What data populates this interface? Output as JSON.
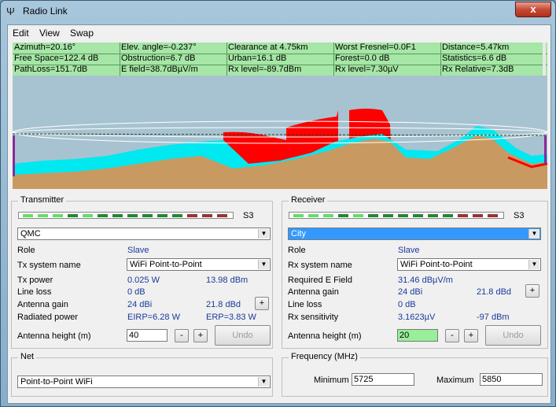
{
  "window": {
    "title": "Radio Link",
    "close_label": "x"
  },
  "menu": {
    "edit": "Edit",
    "view": "View",
    "swap": "Swap"
  },
  "info": {
    "row1": [
      "Azimuth=20.16°",
      "Elev. angle=-0.237°",
      "Clearance at 4.75km",
      "Worst Fresnel=0.0F1",
      "Distance=5.47km"
    ],
    "row2": [
      "Free Space=122.4 dB",
      "Obstruction=6.7 dB",
      "Urban=16.1 dB",
      "Forest=0.0 dB",
      "Statistics=6.6 dB"
    ],
    "row3": [
      "PathLoss=151.7dB",
      "E field=38.7dBµV/m",
      "Rx level=-89.7dBm",
      "Rx level=7.30µV",
      "Rx Relative=7.3dB"
    ]
  },
  "transmitter": {
    "title": "Transmitter",
    "signal_label": "S3",
    "station": "QMC",
    "role_label": "Role",
    "role_value": "Slave",
    "system_label": "Tx system name",
    "system_value": "WiFi Point-to-Point",
    "power_label": "Tx power",
    "power_w": "0.025 W",
    "power_dbm": "13.98 dBm",
    "lineloss_label": "Line loss",
    "lineloss_value": "0 dB",
    "gain_label": "Antenna gain",
    "gain_dbi": "24 dBi",
    "gain_dbd": "21.8 dBd",
    "radiated_label": "Radiated power",
    "eirp": "EIRP=6.28 W",
    "erp": "ERP=3.83 W",
    "height_label": "Antenna height (m)",
    "height_value": "40",
    "minus": "-",
    "plus": "+",
    "undo": "Undo"
  },
  "receiver": {
    "title": "Receiver",
    "signal_label": "S3",
    "station": "City",
    "role_label": "Role",
    "role_value": "Slave",
    "system_label": "Rx system name",
    "system_value": "WiFi Point-to-Point",
    "efield_label": "Required E Field",
    "efield_value": "31.46 dBµV/m",
    "gain_label": "Antenna gain",
    "gain_dbi": "24 dBi",
    "gain_dbd": "21.8 dBd",
    "lineloss_label": "Line loss",
    "lineloss_value": "0 dB",
    "sens_label": "Rx sensitivity",
    "sens_uv": "3.1623µV",
    "sens_dbm": "-97 dBm",
    "height_label": "Antenna height (m)",
    "height_value": "20",
    "minus": "-",
    "plus": "+",
    "undo": "Undo"
  },
  "net": {
    "title": "Net",
    "value": "Point-to-Point WiFi"
  },
  "frequency": {
    "title": "Frequency (MHz)",
    "min_label": "Minimum",
    "min_value": "5725",
    "max_label": "Maximum",
    "max_value": "5850"
  },
  "colors": {
    "terrain": "#c89a62",
    "clutter": "#00e8f0",
    "obstruction": "#ff0000",
    "sky": "#a7c3d1",
    "info_bg": "#a6e6a6"
  },
  "meter": {
    "bright": "#66dd66",
    "dark": "#228833",
    "red": "#993333"
  }
}
